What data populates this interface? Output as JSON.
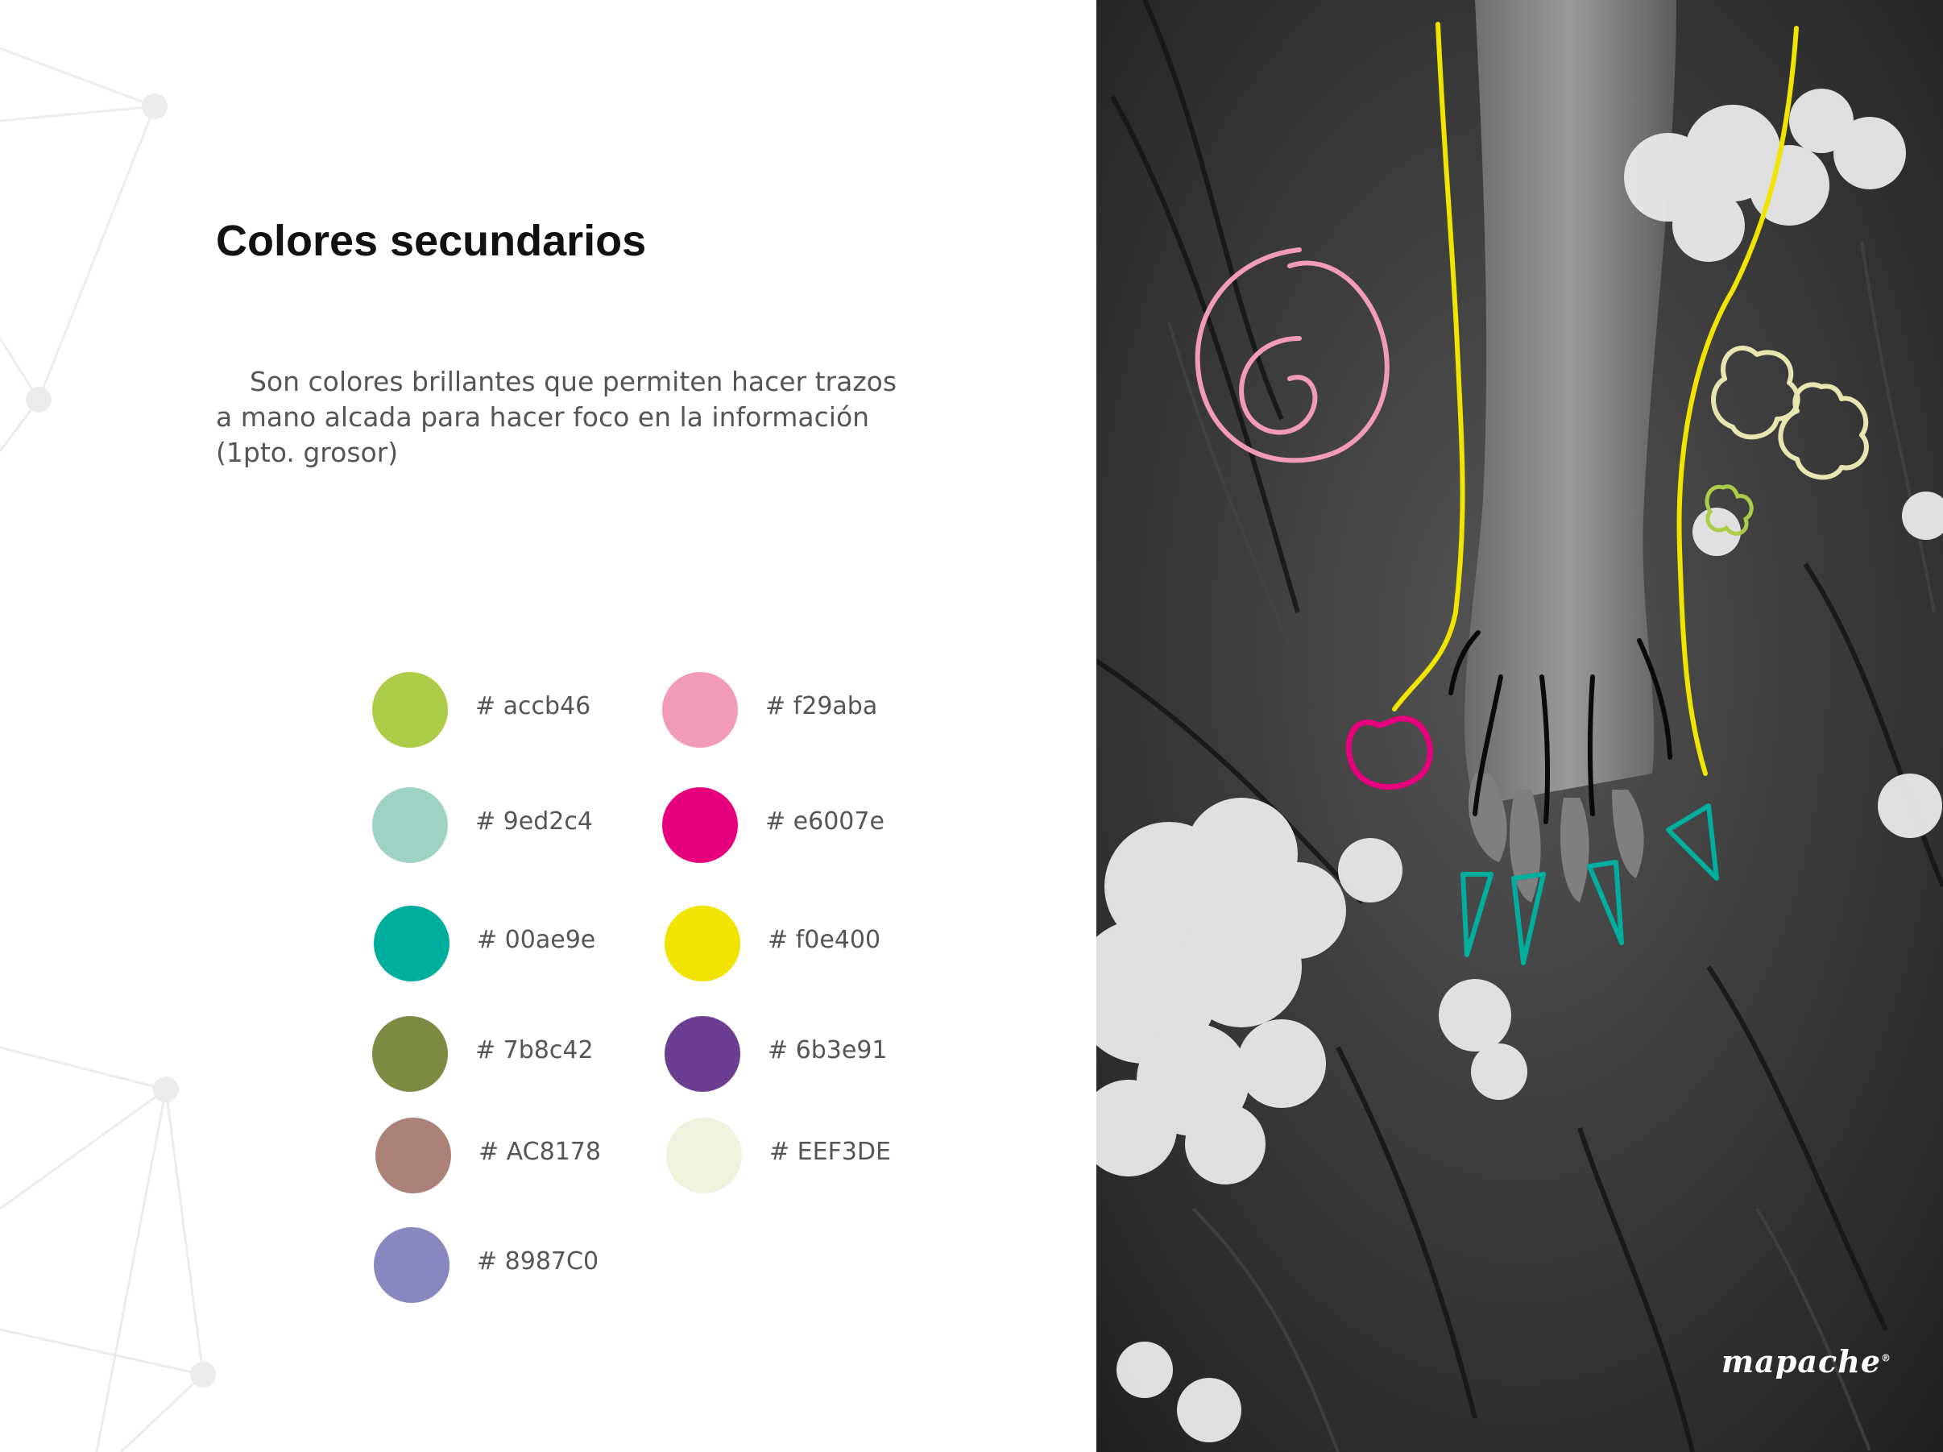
{
  "page": {
    "title": "Colores secundarios",
    "description": "Son colores brillantes que permiten hacer trazos a mano alcada para hacer  foco en la información (1pto. grosor)"
  },
  "palette": [
    {
      "label": "# accb46",
      "color": "#accb46"
    },
    {
      "label": "# f29aba",
      "color": "#f29aba"
    },
    {
      "label": "# 9ed2c4",
      "color": "#9ed2c4"
    },
    {
      "label": "# e6007e",
      "color": "#e6007e"
    },
    {
      "label": "# 00ae9e",
      "color": "#00ae9e"
    },
    {
      "label": "# f0e400",
      "color": "#f0e400"
    },
    {
      "label": "# 7b8c42",
      "color": "#7b8c42"
    },
    {
      "label": "# 6b3e91",
      "color": "#6b3e91"
    },
    {
      "label": "# AC8178",
      "color": "#AC8178"
    },
    {
      "label": "# EEF3DE",
      "color": "#EEF3DE"
    },
    {
      "label": "# 8987C0",
      "color": "#8987C0"
    }
  ],
  "photo": {
    "logo": "mapache",
    "logo_mark": "®"
  }
}
